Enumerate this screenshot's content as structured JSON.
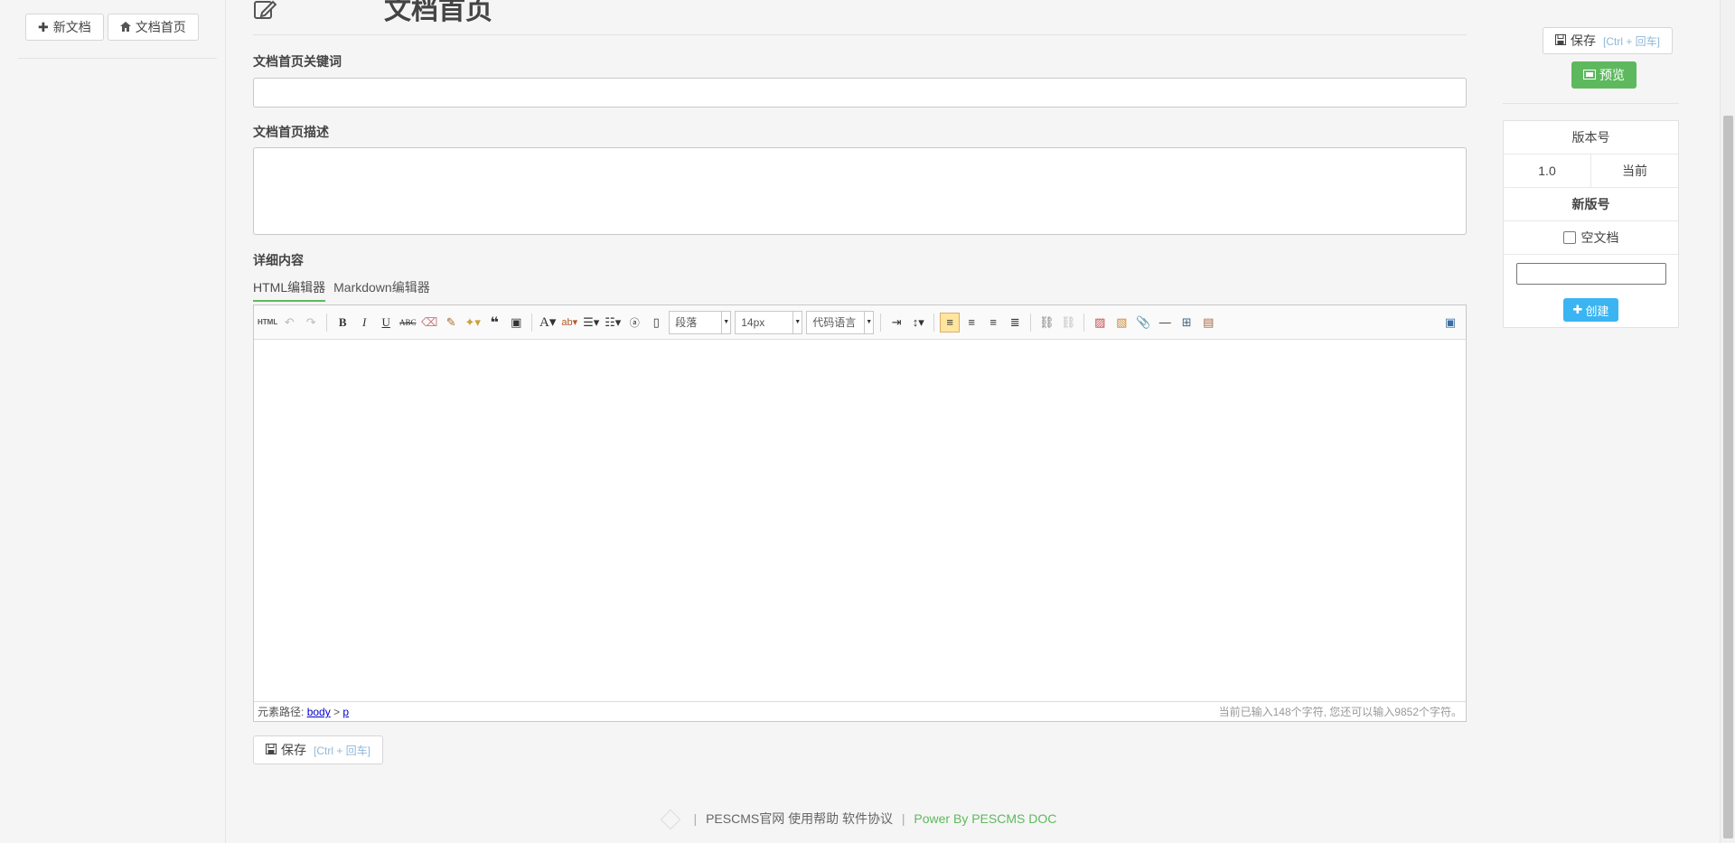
{
  "left_sidebar": {
    "new_doc_label": "新文档",
    "doc_home_label": "文档首页"
  },
  "main": {
    "page_title": "文档首页",
    "keywords_label": "文档首页关键词",
    "keywords_value": "",
    "description_label": "文档首页描述",
    "description_value": "",
    "content_label": "详细内容",
    "tabs": [
      {
        "label": "HTML编辑器",
        "active": true
      },
      {
        "label": "Markdown编辑器",
        "active": false
      }
    ],
    "editor": {
      "source_button": "HTML",
      "paragraph_select": "段落",
      "fontsize_select": "14px",
      "code_select": "代码语言",
      "path_label": "元素路径:",
      "path_body": "body",
      "path_sep": ">",
      "path_p": "p",
      "char_count": "当前已输入148个字符, 您还可以输入9852个字符。"
    },
    "save_label": "保存",
    "save_hint": "[Ctrl + 回车]"
  },
  "footer": {
    "links": [
      "PESCMS官网",
      "使用帮助",
      "软件协议"
    ],
    "power": "Power By PESCMS DOC"
  },
  "right_panel": {
    "save_label": "保存",
    "save_hint": "[Ctrl + 回车]",
    "preview_label": "预览",
    "version_header": "版本号",
    "version_value": "1.0",
    "current_label": "当前",
    "new_version_header": "新版号",
    "empty_doc_label": "空文档",
    "create_label": "创建"
  },
  "colors": {
    "accent_green": "#5eb95e",
    "accent_blue": "#3bb4f2",
    "background": "#f5f5f5"
  }
}
